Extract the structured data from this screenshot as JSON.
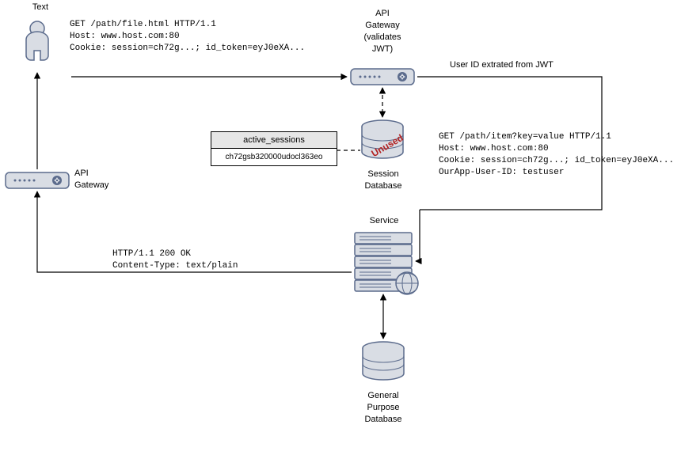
{
  "labels": {
    "user": "Text",
    "gateway_top": "API\nGateway\n(validates\nJWT)",
    "gateway_left": "API\nGateway",
    "session_db": "Session\nDatabase",
    "service": "Service",
    "general_db": "General\nPurpose\nDatabase",
    "arrow_jwt": "User ID extrated from JWT",
    "unused_stamp": "Unused"
  },
  "http": {
    "request1": "GET /path/file.html HTTP/1.1\nHost: www.host.com:80\nCookie: session=ch72g...; id_token=eyJ0eXA...",
    "request2": "GET /path/item?key=value HTTP/1.1\nHost: www.host.com:80\nCookie: session=ch72g...; id_token=eyJ0eXA...\nOurApp-User-ID: testuser",
    "response": "HTTP/1.1 200 OK\nContent-Type: text/plain"
  },
  "session_table": {
    "name": "active_sessions",
    "row": "ch72gsb320000udocl363eo"
  }
}
